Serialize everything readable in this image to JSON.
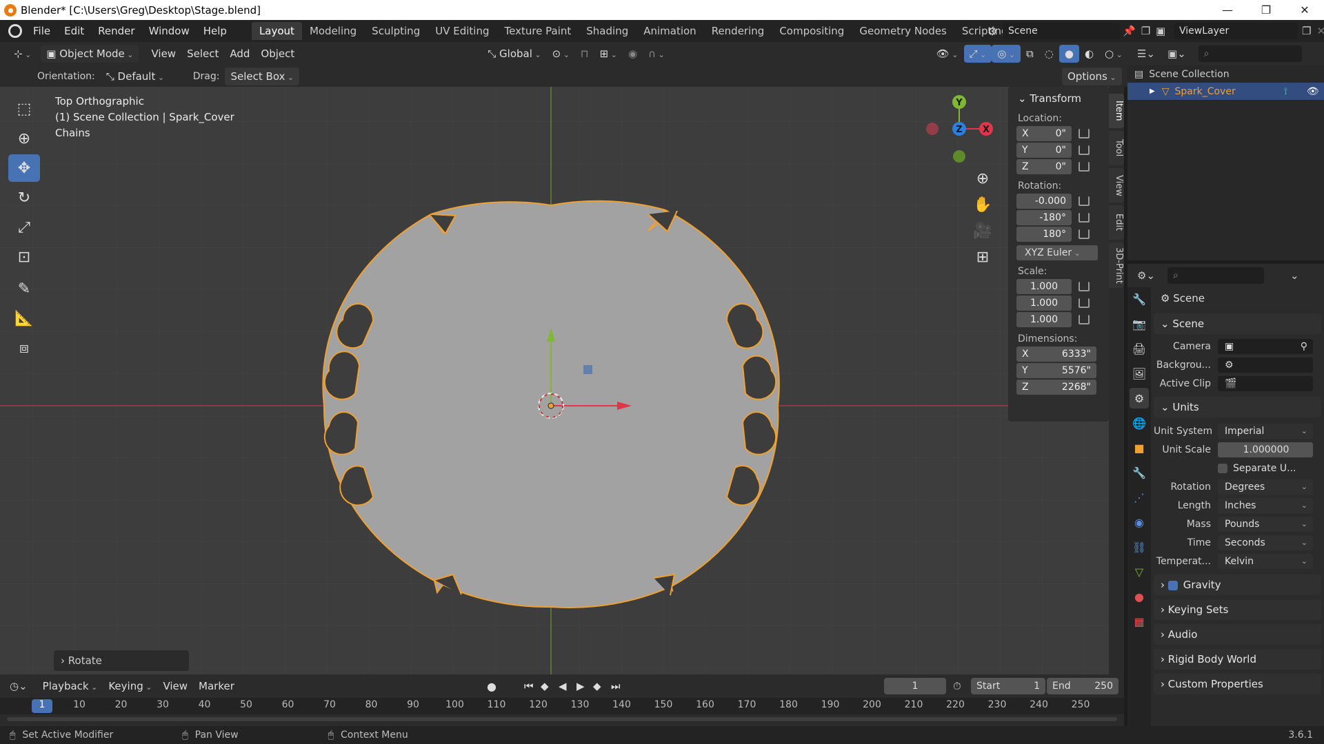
{
  "window": {
    "title": "Blender* [C:\\Users\\Greg\\Desktop\\Stage.blend]",
    "minimize": "—",
    "maximize": "❐",
    "close": "✕"
  },
  "menu": [
    "File",
    "Edit",
    "Render",
    "Window",
    "Help"
  ],
  "workspaces": [
    "Layout",
    "Modeling",
    "Sculpting",
    "UV Editing",
    "Texture Paint",
    "Shading",
    "Animation",
    "Rendering",
    "Compositing",
    "Geometry Nodes",
    "Scripting"
  ],
  "active_workspace": "Layout",
  "add_workspace": "+",
  "scene_field": "Scene",
  "viewlayer_field": "ViewLayer",
  "header3d": {
    "mode": "Object Mode",
    "menus": [
      "View",
      "Select",
      "Add",
      "Object"
    ],
    "transform_orientation": "Global"
  },
  "toolsettings": {
    "orientation_label": "Orientation:",
    "orientation_value": "Default",
    "drag_label": "Drag:",
    "drag_value": "Select Box",
    "options": "Options"
  },
  "viewport": {
    "view_name": "Top Orthographic",
    "collection_line": "(1) Scene Collection | Spark_Cover",
    "object_name": "Chains",
    "bg": "#3d3d3d",
    "grid": "#474747"
  },
  "gizmo": {
    "x": "X",
    "y": "Y",
    "z": "Z",
    "x_color": "#e0364a",
    "y_color": "#7fb832",
    "z_color": "#2b7fe0"
  },
  "rotate_panel": "Rotate",
  "npanel": {
    "header": "Transform",
    "location_label": "Location:",
    "location": [
      {
        "axis": "X",
        "value": "0\""
      },
      {
        "axis": "Y",
        "value": "0\""
      },
      {
        "axis": "Z",
        "value": "0\""
      }
    ],
    "rotation_label": "Rotation:",
    "rotation": [
      "-0.000",
      "-180°",
      "180°"
    ],
    "rotation_mode": "XYZ Euler",
    "scale_label": "Scale:",
    "scale": [
      "1.000",
      "1.000",
      "1.000"
    ],
    "dimensions_label": "Dimensions:",
    "dimensions": [
      {
        "axis": "X",
        "value": "6333\""
      },
      {
        "axis": "Y",
        "value": "5576\""
      },
      {
        "axis": "Z",
        "value": "2268\""
      }
    ]
  },
  "sidetabs": [
    "Item",
    "Tool",
    "View",
    "Edit",
    "3D-Print"
  ],
  "outliner": {
    "scene_collection": "Scene Collection",
    "object": "Spark_Cover"
  },
  "properties": {
    "context": "Scene",
    "scene_section": "Scene",
    "camera_label": "Camera",
    "background_label": "Backgrou...",
    "active_clip_label": "Active Clip",
    "units_section": "Units",
    "unit_system_label": "Unit System",
    "unit_system": "Imperial",
    "unit_scale_label": "Unit Scale",
    "unit_scale": "1.000000",
    "separate_units": "Separate U...",
    "rotation_label": "Rotation",
    "rotation": "Degrees",
    "length_label": "Length",
    "length": "Inches",
    "mass_label": "Mass",
    "mass": "Pounds",
    "time_label": "Time",
    "time": "Seconds",
    "temperature_label": "Temperat...",
    "temperature": "Kelvin",
    "gravity": "Gravity",
    "keying_sets": "Keying Sets",
    "audio": "Audio",
    "rigid_body_world": "Rigid Body World",
    "custom_properties": "Custom Properties"
  },
  "timeline": {
    "menus": [
      "Playback",
      "Keying",
      "View",
      "Marker"
    ],
    "current_frame": "1",
    "start_label": "Start",
    "start": "1",
    "end_label": "End",
    "end": "250",
    "ticks": [
      "1",
      "10",
      "20",
      "30",
      "40",
      "50",
      "60",
      "70",
      "80",
      "90",
      "100",
      "110",
      "120",
      "130",
      "140",
      "150",
      "160",
      "170",
      "180",
      "190",
      "200",
      "210",
      "220",
      "230",
      "240",
      "250"
    ]
  },
  "statusbar": {
    "left": "Set Active Modifier",
    "middle": "Pan View",
    "right": "Context Menu",
    "version": "3.6.1"
  },
  "colors": {
    "accent": "#4772b3",
    "selection_outline": "#f0a030",
    "object_fill": "#a2a2a2",
    "header_bg": "#2b2b2b"
  }
}
